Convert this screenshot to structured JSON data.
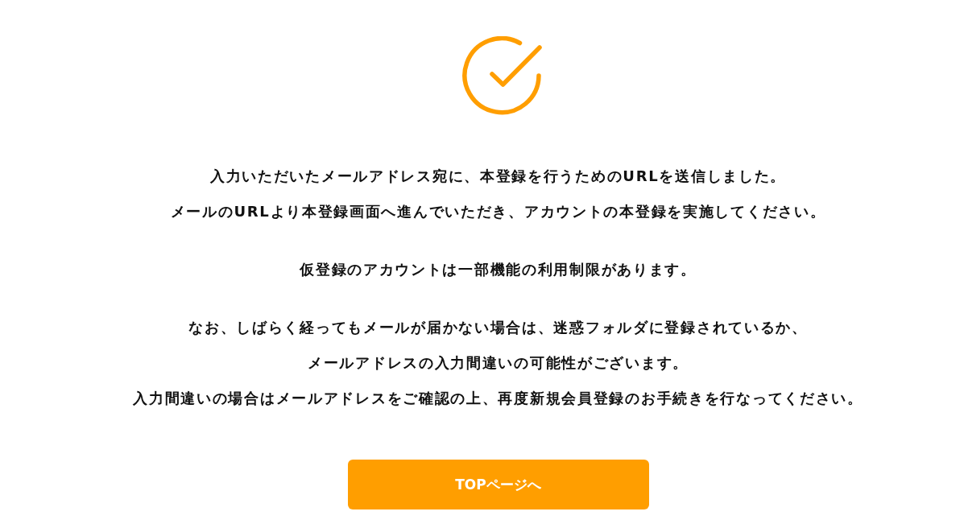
{
  "message": {
    "paragraphs": [
      [
        "入力いただいたメールアドレス宛に、本登録を行うためのURLを送信しました。",
        "メールのURLより本登録画面へ進んでいただき、アカウントの本登録を実施してください。"
      ],
      [
        "仮登録のアカウントは一部機能の利用制限があります。"
      ],
      [
        "なお、しばらく経ってもメールが届かない場合は、迷惑フォルダに登録されているか、",
        "メールアドレスの入力間違いの可能性がございます。",
        "入力間違いの場合はメールアドレスをご確認の上、再度新規会員登録のお手続きを行なってください。"
      ]
    ]
  },
  "button": {
    "label": "TOPページへ"
  }
}
